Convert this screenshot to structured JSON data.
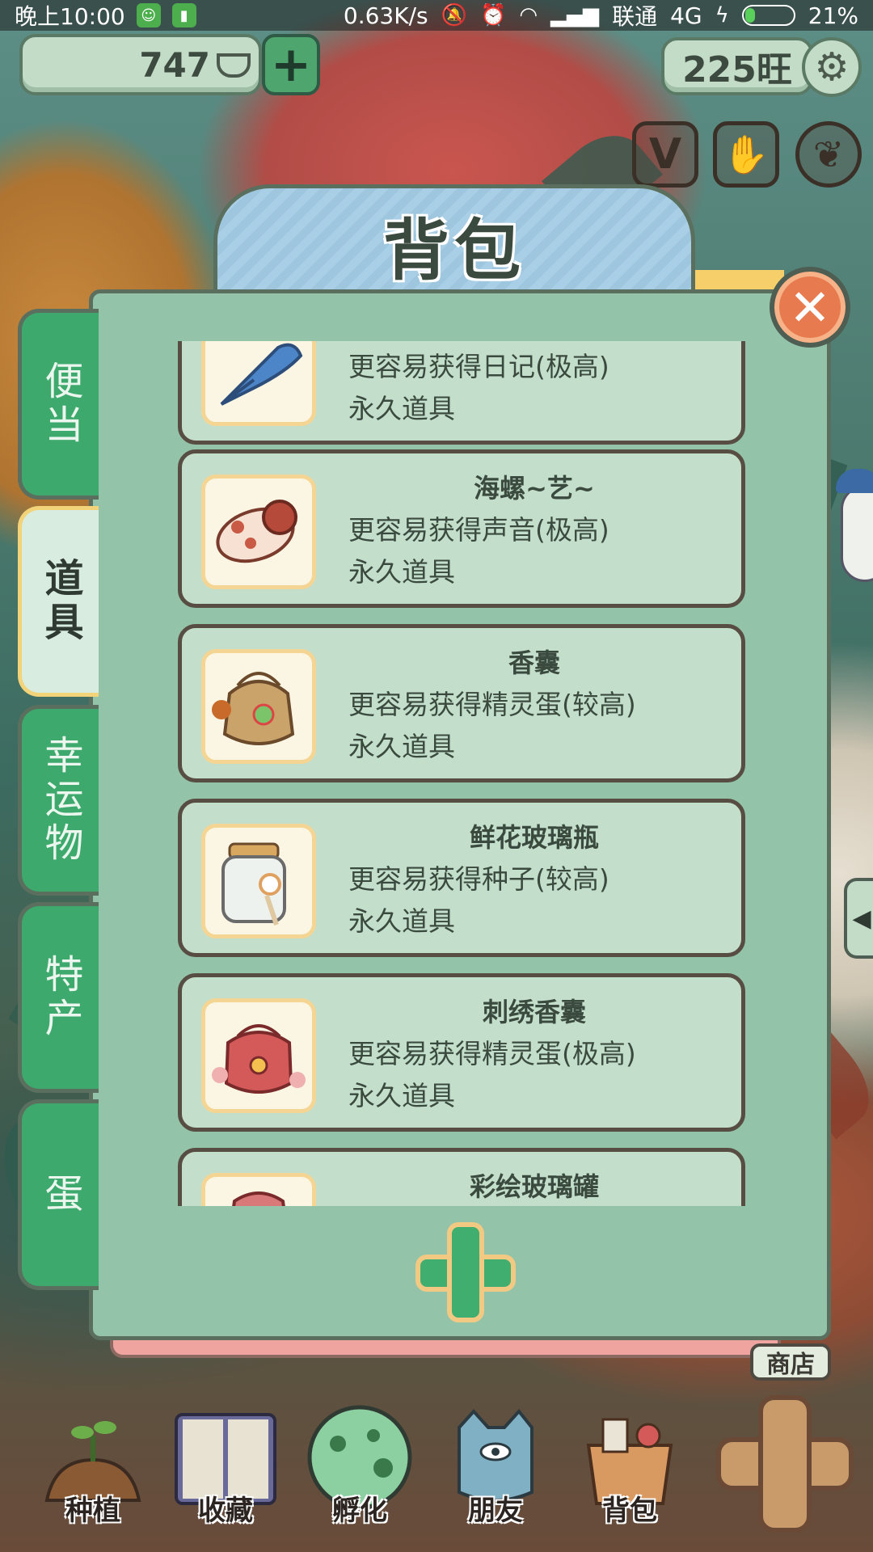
{
  "status_bar": {
    "time": "晚上10:00",
    "network_speed": "0.63K/s",
    "carrier": "联通",
    "network_type": "4G",
    "battery": "21%",
    "battery_level": 0.21
  },
  "hud": {
    "coins": "747",
    "wang": "225旺",
    "buttons": [
      "V",
      "hand-icon",
      "ginkgo-leaf-icon"
    ]
  },
  "dialog": {
    "title": "背包",
    "tabs": [
      {
        "label": "便当",
        "active": false
      },
      {
        "label": "道具",
        "active": true
      },
      {
        "label": "幸运物",
        "active": false
      },
      {
        "label": "特产",
        "active": false
      },
      {
        "label": "蛋",
        "active": false
      }
    ],
    "items": [
      {
        "name": "",
        "desc": "更容易获得日记(极高)",
        "perm": "永久道具",
        "icon": "blue-quill-icon"
      },
      {
        "name": "海螺~艺~",
        "desc": "更容易获得声音(极高)",
        "perm": "永久道具",
        "icon": "conch-shell-icon"
      },
      {
        "name": "香囊",
        "desc": "更容易获得精灵蛋(较高)",
        "perm": "永久道具",
        "icon": "sachet-icon"
      },
      {
        "name": "鲜花玻璃瓶",
        "desc": "更容易获得种子(较高)",
        "perm": "永久道具",
        "icon": "flower-jar-icon"
      },
      {
        "name": "刺绣香囊",
        "desc": "更容易获得精灵蛋(极高)",
        "perm": "永久道具",
        "icon": "embroidered-sachet-icon"
      },
      {
        "name": "彩绘玻璃罐",
        "desc": "",
        "perm": "",
        "icon": "painted-jar-icon"
      }
    ]
  },
  "bottom_nav": {
    "shop": "商店",
    "items": [
      {
        "label": "种植",
        "icon": "plant-icon"
      },
      {
        "label": "收藏",
        "icon": "book-icon"
      },
      {
        "label": "孵化",
        "icon": "egg-icon"
      },
      {
        "label": "朋友",
        "icon": "cat-icon"
      },
      {
        "label": "背包",
        "icon": "basket-icon"
      }
    ]
  },
  "colors": {
    "panel": "#93c3a9",
    "item_bg": "#c3dfcb",
    "tab_green": "#3da96c",
    "close_orange": "#e87a4f",
    "title_blue": "#a9cfe6"
  }
}
